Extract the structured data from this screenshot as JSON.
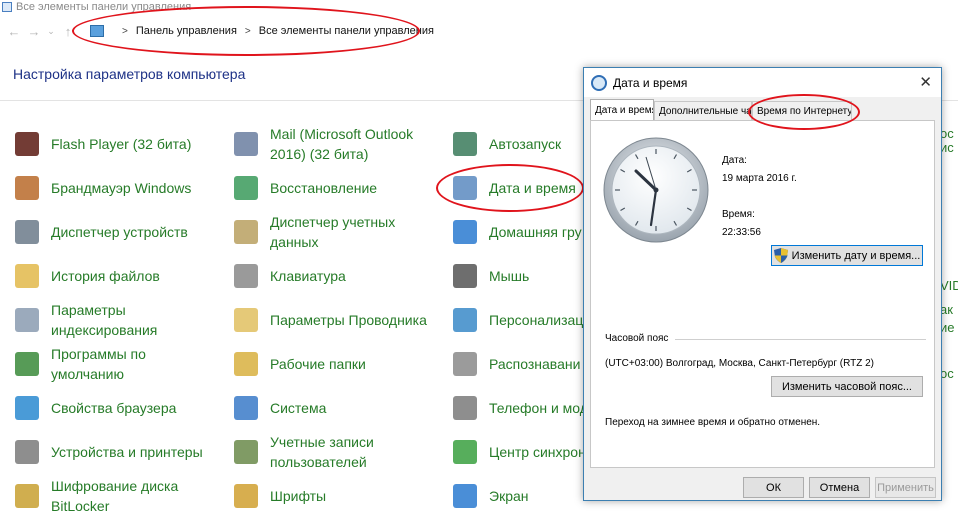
{
  "window": {
    "title": "Все элементы панели управления"
  },
  "nav": {
    "back": "←",
    "forward": "→",
    "dropdown": "⌄",
    "up": "↑"
  },
  "breadcrumb": {
    "sep": ">",
    "items": [
      "Панель управления",
      "Все элементы панели управления"
    ]
  },
  "page": {
    "heading": "Настройка параметров компьютера"
  },
  "columns": [
    [
      {
        "icon": "flash-player-icon",
        "color": "#5b1a12",
        "label": "Flash Player (32 бита)"
      },
      {
        "icon": "firewall-icon",
        "color": "#b86a2a",
        "label": "Брандмауэр Windows"
      },
      {
        "icon": "device-manager-icon",
        "color": "#6b7a8a",
        "label": "Диспетчер устройств"
      },
      {
        "icon": "file-history-icon",
        "color": "#e2b84a",
        "label": "История файлов"
      },
      {
        "icon": "indexing-options-icon",
        "color": "#8a9bb0",
        "label": "Параметры\nиндексирования"
      },
      {
        "icon": "default-programs-icon",
        "color": "#3a8a3a",
        "label": "Программы по\nумолчанию"
      },
      {
        "icon": "internet-options-icon",
        "color": "#2a8ad0",
        "label": "Свойства браузера"
      },
      {
        "icon": "devices-printers-icon",
        "color": "#7a7a7a",
        "label": "Устройства и принтеры"
      },
      {
        "icon": "bitlocker-icon",
        "color": "#c8a030",
        "label": "Шифрование диска\nBitLocker"
      }
    ],
    [
      {
        "icon": "mail-icon",
        "color": "#6a7ea0",
        "label": "Mail (Microsoft Outlook\n2016) (32 бита)"
      },
      {
        "icon": "recovery-icon",
        "color": "#3a9a5a",
        "label": "Восстановление"
      },
      {
        "icon": "credential-manager-icon",
        "color": "#b8a060",
        "label": "Диспетчер учетных\nданных"
      },
      {
        "icon": "keyboard-icon",
        "color": "#888888",
        "label": "Клавиатура"
      },
      {
        "icon": "file-explorer-options-icon",
        "color": "#e0c060",
        "label": "Параметры Проводника"
      },
      {
        "icon": "work-folders-icon",
        "color": "#d8b040",
        "label": "Рабочие папки"
      },
      {
        "icon": "system-icon",
        "color": "#3a7ac8",
        "label": "Система"
      },
      {
        "icon": "user-accounts-icon",
        "color": "#6a8a4a",
        "label": "Учетные записи\nпользователей"
      },
      {
        "icon": "fonts-icon",
        "color": "#d0a030",
        "label": "Шрифты"
      }
    ],
    [
      {
        "icon": "autoplay-icon",
        "color": "#3a7a5a",
        "label": "Автозапуск"
      },
      {
        "icon": "date-time-icon",
        "color": "#5a8ac0",
        "label": "Дата и время"
      },
      {
        "icon": "homegroup-icon",
        "color": "#2a7ad0",
        "label": "Домашняя гру"
      },
      {
        "icon": "mouse-icon",
        "color": "#555555",
        "label": "Мышь"
      },
      {
        "icon": "personalization-icon",
        "color": "#3a8ac8",
        "label": "Персонализац"
      },
      {
        "icon": "speech-recognition-icon",
        "color": "#8a8a8a",
        "label": "Распознавани"
      },
      {
        "icon": "phone-modem-icon",
        "color": "#7a7a7a",
        "label": "Телефон и мод"
      },
      {
        "icon": "sync-center-icon",
        "color": "#3aa040",
        "label": "Центр синхрон"
      },
      {
        "icon": "display-icon",
        "color": "#2a7ad0",
        "label": "Экран"
      }
    ]
  ],
  "right_partial": [
    "ос",
    "ис",
    "VID",
    "ак",
    "ие",
    "ос"
  ],
  "dialog": {
    "title": "Дата и время",
    "close": "✕",
    "tabs": [
      "Дата и время",
      "Дополнительные часы",
      "Время по Интернету"
    ],
    "date_label": "Дата:",
    "date_value": "19 марта 2016 г.",
    "time_label": "Время:",
    "time_value": "22:33:56",
    "change_datetime_button": "Изменить дату и время...",
    "timezone_label": "Часовой пояс",
    "timezone_value": "(UTC+03:00) Волгоград, Москва, Санкт-Петербург (RTZ 2)",
    "change_timezone_button": "Изменить часовой пояс...",
    "dst_note": "Переход на зимнее время и обратно отменен.",
    "ok_button": "ОК",
    "cancel_button": "Отмена",
    "apply_button": "Применить"
  },
  "colors": {
    "link_green": "#267b28",
    "heading_blue": "#1e3287",
    "annotation_red": "#e0141c",
    "dialog_border": "#3c7fb1"
  }
}
